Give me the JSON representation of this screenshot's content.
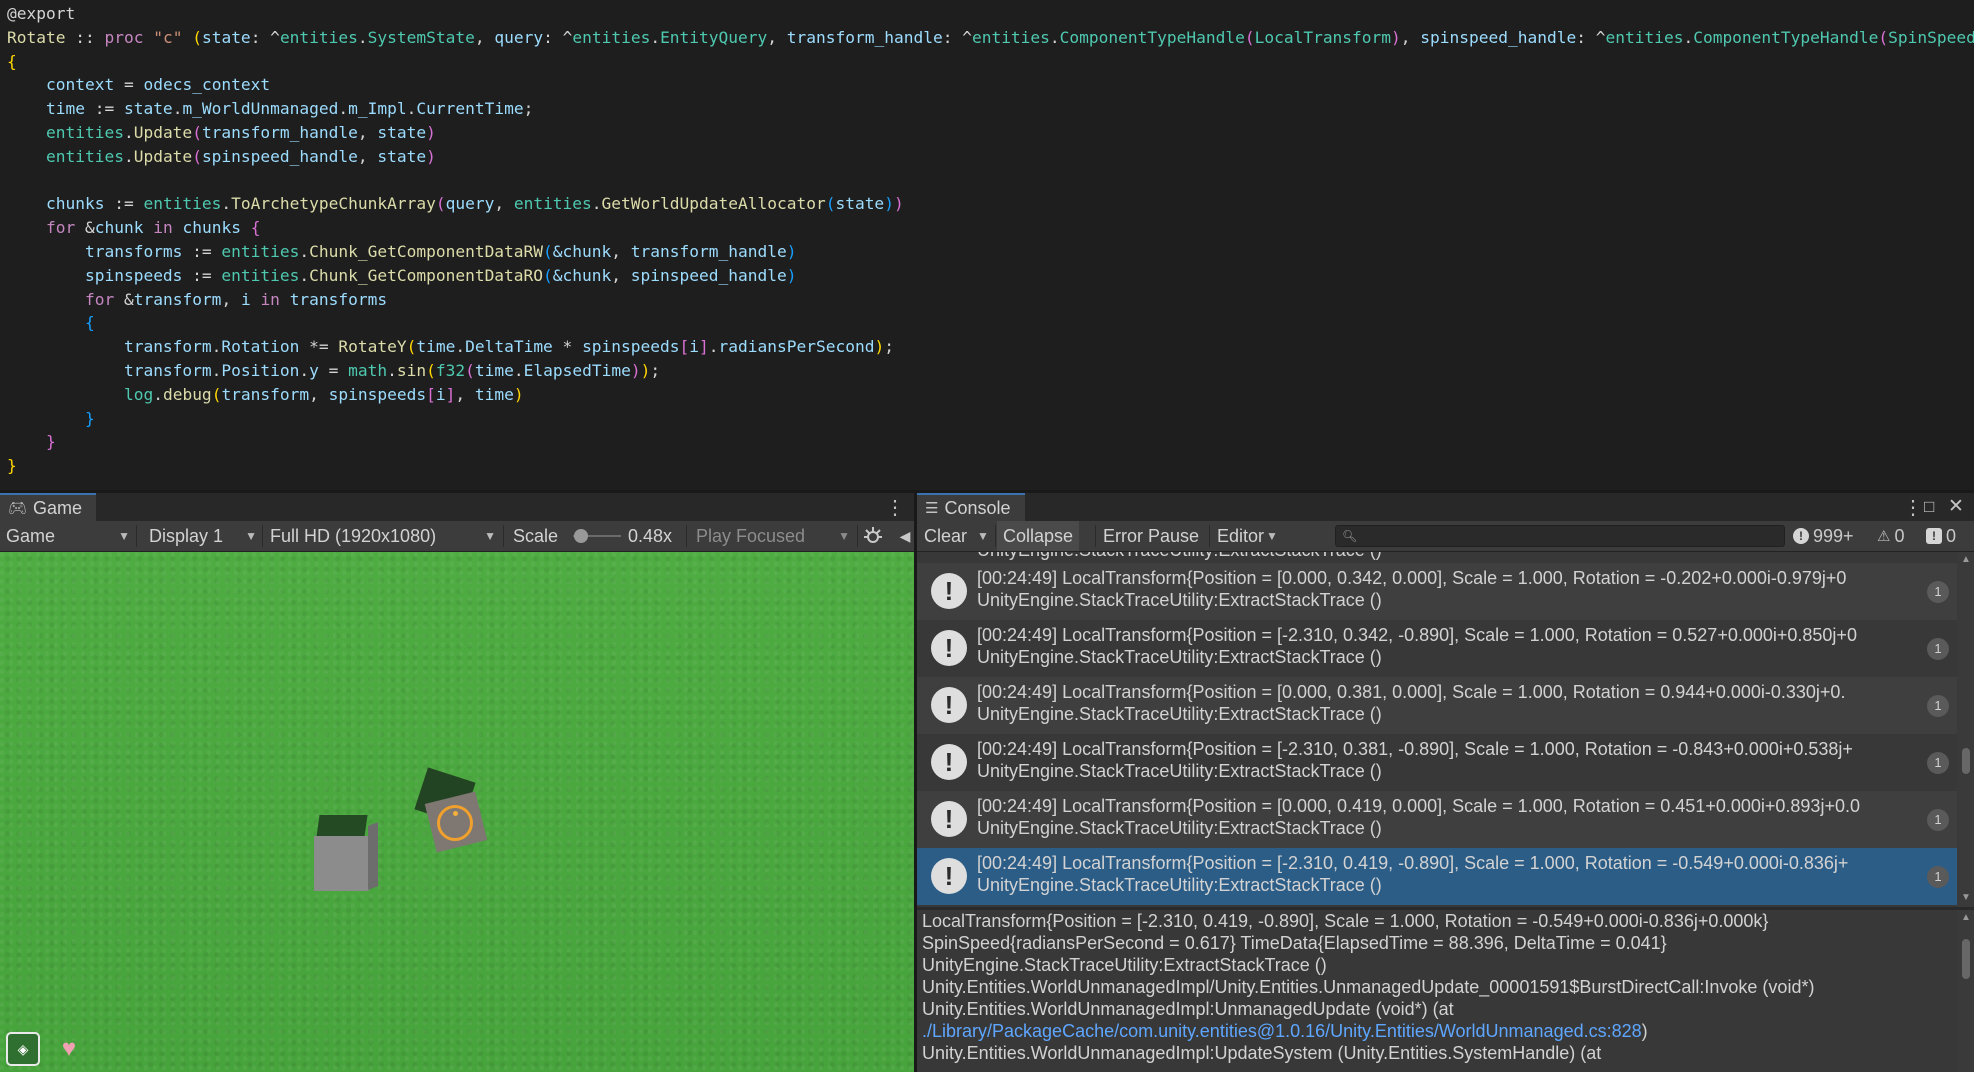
{
  "code_lines": [
    [
      {
        "t": "@export",
        "c": "attr"
      }
    ],
    [
      {
        "t": "Rotate",
        "c": "fn"
      },
      {
        "t": " :: ",
        "c": "op"
      },
      {
        "t": "proc",
        "c": "kw"
      },
      {
        "t": " ",
        "c": "op"
      },
      {
        "t": "\"c\"",
        "c": "str"
      },
      {
        "t": " ",
        "c": "op"
      },
      {
        "t": "(",
        "c": "b1"
      },
      {
        "t": "state",
        "c": "var"
      },
      {
        "t": ": ^",
        "c": "op"
      },
      {
        "t": "entities",
        "c": "ty"
      },
      {
        "t": ".",
        "c": "op"
      },
      {
        "t": "SystemState",
        "c": "ty"
      },
      {
        "t": ", ",
        "c": "op"
      },
      {
        "t": "query",
        "c": "var"
      },
      {
        "t": ": ^",
        "c": "op"
      },
      {
        "t": "entities",
        "c": "ty"
      },
      {
        "t": ".",
        "c": "op"
      },
      {
        "t": "EntityQuery",
        "c": "ty"
      },
      {
        "t": ", ",
        "c": "op"
      },
      {
        "t": "transform_handle",
        "c": "var"
      },
      {
        "t": ": ^",
        "c": "op"
      },
      {
        "t": "entities",
        "c": "ty"
      },
      {
        "t": ".",
        "c": "op"
      },
      {
        "t": "ComponentTypeHandle",
        "c": "ty"
      },
      {
        "t": "(",
        "c": "b2"
      },
      {
        "t": "LocalTransform",
        "c": "ty"
      },
      {
        "t": ")",
        "c": "b2"
      },
      {
        "t": ", ",
        "c": "op"
      },
      {
        "t": "spinspeed_handle",
        "c": "var"
      },
      {
        "t": ": ^",
        "c": "op"
      },
      {
        "t": "entities",
        "c": "ty"
      },
      {
        "t": ".",
        "c": "op"
      },
      {
        "t": "ComponentTypeHandle",
        "c": "ty"
      },
      {
        "t": "(",
        "c": "b2"
      },
      {
        "t": "SpinSpeed",
        "c": "ty"
      },
      {
        "t": ")",
        "c": "b2"
      },
      {
        "t": ")",
        "c": "b1"
      }
    ],
    [
      {
        "t": "{",
        "c": "b1"
      }
    ],
    [
      {
        "t": "    ",
        "c": "op"
      },
      {
        "t": "context",
        "c": "var"
      },
      {
        "t": " = ",
        "c": "op"
      },
      {
        "t": "odecs_context",
        "c": "var"
      }
    ],
    [
      {
        "t": "    ",
        "c": "op"
      },
      {
        "t": "time",
        "c": "var"
      },
      {
        "t": " := ",
        "c": "op"
      },
      {
        "t": "state",
        "c": "var"
      },
      {
        "t": ".",
        "c": "op"
      },
      {
        "t": "m_WorldUnmanaged",
        "c": "var"
      },
      {
        "t": ".",
        "c": "op"
      },
      {
        "t": "m_Impl",
        "c": "var"
      },
      {
        "t": ".",
        "c": "op"
      },
      {
        "t": "CurrentTime",
        "c": "var"
      },
      {
        "t": ";",
        "c": "op"
      }
    ],
    [
      {
        "t": "    ",
        "c": "op"
      },
      {
        "t": "entities",
        "c": "ty"
      },
      {
        "t": ".",
        "c": "op"
      },
      {
        "t": "Update",
        "c": "fn"
      },
      {
        "t": "(",
        "c": "b2"
      },
      {
        "t": "transform_handle",
        "c": "var"
      },
      {
        "t": ", ",
        "c": "op"
      },
      {
        "t": "state",
        "c": "var"
      },
      {
        "t": ")",
        "c": "b2"
      }
    ],
    [
      {
        "t": "    ",
        "c": "op"
      },
      {
        "t": "entities",
        "c": "ty"
      },
      {
        "t": ".",
        "c": "op"
      },
      {
        "t": "Update",
        "c": "fn"
      },
      {
        "t": "(",
        "c": "b2"
      },
      {
        "t": "spinspeed_handle",
        "c": "var"
      },
      {
        "t": ", ",
        "c": "op"
      },
      {
        "t": "state",
        "c": "var"
      },
      {
        "t": ")",
        "c": "b2"
      }
    ],
    [
      {
        "t": "",
        "c": "op"
      }
    ],
    [
      {
        "t": "    ",
        "c": "op"
      },
      {
        "t": "chunks",
        "c": "var"
      },
      {
        "t": " := ",
        "c": "op"
      },
      {
        "t": "entities",
        "c": "ty"
      },
      {
        "t": ".",
        "c": "op"
      },
      {
        "t": "ToArchetypeChunkArray",
        "c": "fn"
      },
      {
        "t": "(",
        "c": "b2"
      },
      {
        "t": "query",
        "c": "var"
      },
      {
        "t": ", ",
        "c": "op"
      },
      {
        "t": "entities",
        "c": "ty"
      },
      {
        "t": ".",
        "c": "op"
      },
      {
        "t": "GetWorldUpdateAllocator",
        "c": "fn"
      },
      {
        "t": "(",
        "c": "b3"
      },
      {
        "t": "state",
        "c": "var"
      },
      {
        "t": ")",
        "c": "b3"
      },
      {
        "t": ")",
        "c": "b2"
      }
    ],
    [
      {
        "t": "    ",
        "c": "op"
      },
      {
        "t": "for",
        "c": "kw"
      },
      {
        "t": " &",
        "c": "op"
      },
      {
        "t": "chunk",
        "c": "var"
      },
      {
        "t": " ",
        "c": "op"
      },
      {
        "t": "in",
        "c": "kw"
      },
      {
        "t": " ",
        "c": "op"
      },
      {
        "t": "chunks",
        "c": "var"
      },
      {
        "t": " ",
        "c": "op"
      },
      {
        "t": "{",
        "c": "b2"
      }
    ],
    [
      {
        "t": "        ",
        "c": "op"
      },
      {
        "t": "transforms",
        "c": "var"
      },
      {
        "t": " := ",
        "c": "op"
      },
      {
        "t": "entities",
        "c": "ty"
      },
      {
        "t": ".",
        "c": "op"
      },
      {
        "t": "Chunk_GetComponentDataRW",
        "c": "fn"
      },
      {
        "t": "(",
        "c": "b3"
      },
      {
        "t": "&chunk",
        "c": "var"
      },
      {
        "t": ", ",
        "c": "op"
      },
      {
        "t": "transform_handle",
        "c": "var"
      },
      {
        "t": ")",
        "c": "b3"
      }
    ],
    [
      {
        "t": "        ",
        "c": "op"
      },
      {
        "t": "spinspeeds",
        "c": "var"
      },
      {
        "t": " := ",
        "c": "op"
      },
      {
        "t": "entities",
        "c": "ty"
      },
      {
        "t": ".",
        "c": "op"
      },
      {
        "t": "Chunk_GetComponentDataRO",
        "c": "fn"
      },
      {
        "t": "(",
        "c": "b3"
      },
      {
        "t": "&chunk",
        "c": "var"
      },
      {
        "t": ", ",
        "c": "op"
      },
      {
        "t": "spinspeed_handle",
        "c": "var"
      },
      {
        "t": ")",
        "c": "b3"
      }
    ],
    [
      {
        "t": "        ",
        "c": "op"
      },
      {
        "t": "for",
        "c": "kw"
      },
      {
        "t": " &",
        "c": "op"
      },
      {
        "t": "transform",
        "c": "var"
      },
      {
        "t": ", ",
        "c": "op"
      },
      {
        "t": "i",
        "c": "var"
      },
      {
        "t": " ",
        "c": "op"
      },
      {
        "t": "in",
        "c": "kw"
      },
      {
        "t": " ",
        "c": "op"
      },
      {
        "t": "transforms",
        "c": "var"
      }
    ],
    [
      {
        "t": "        ",
        "c": "op"
      },
      {
        "t": "{",
        "c": "b3"
      }
    ],
    [
      {
        "t": "            ",
        "c": "op"
      },
      {
        "t": "transform",
        "c": "var"
      },
      {
        "t": ".",
        "c": "op"
      },
      {
        "t": "Rotation",
        "c": "var"
      },
      {
        "t": " *= ",
        "c": "op"
      },
      {
        "t": "RotateY",
        "c": "fn"
      },
      {
        "t": "(",
        "c": "b1"
      },
      {
        "t": "time",
        "c": "var"
      },
      {
        "t": ".",
        "c": "op"
      },
      {
        "t": "DeltaTime",
        "c": "var"
      },
      {
        "t": " * ",
        "c": "op"
      },
      {
        "t": "spinspeeds",
        "c": "var"
      },
      {
        "t": "[",
        "c": "b2"
      },
      {
        "t": "i",
        "c": "var"
      },
      {
        "t": "]",
        "c": "b2"
      },
      {
        "t": ".",
        "c": "op"
      },
      {
        "t": "radiansPerSecond",
        "c": "var"
      },
      {
        "t": ")",
        "c": "b1"
      },
      {
        "t": ";",
        "c": "op"
      }
    ],
    [
      {
        "t": "            ",
        "c": "op"
      },
      {
        "t": "transform",
        "c": "var"
      },
      {
        "t": ".",
        "c": "op"
      },
      {
        "t": "Position",
        "c": "var"
      },
      {
        "t": ".",
        "c": "op"
      },
      {
        "t": "y",
        "c": "var"
      },
      {
        "t": " = ",
        "c": "op"
      },
      {
        "t": "math",
        "c": "ty"
      },
      {
        "t": ".",
        "c": "op"
      },
      {
        "t": "sin",
        "c": "fn"
      },
      {
        "t": "(",
        "c": "b1"
      },
      {
        "t": "f32",
        "c": "ty"
      },
      {
        "t": "(",
        "c": "b2"
      },
      {
        "t": "time",
        "c": "var"
      },
      {
        "t": ".",
        "c": "op"
      },
      {
        "t": "ElapsedTime",
        "c": "var"
      },
      {
        "t": ")",
        "c": "b2"
      },
      {
        "t": ")",
        "c": "b1"
      },
      {
        "t": ";",
        "c": "op"
      }
    ],
    [
      {
        "t": "            ",
        "c": "op"
      },
      {
        "t": "log",
        "c": "ty"
      },
      {
        "t": ".",
        "c": "op"
      },
      {
        "t": "debug",
        "c": "fn"
      },
      {
        "t": "(",
        "c": "b1"
      },
      {
        "t": "transform",
        "c": "var"
      },
      {
        "t": ", ",
        "c": "op"
      },
      {
        "t": "spinspeeds",
        "c": "var"
      },
      {
        "t": "[",
        "c": "b2"
      },
      {
        "t": "i",
        "c": "var"
      },
      {
        "t": "]",
        "c": "b2"
      },
      {
        "t": ", ",
        "c": "op"
      },
      {
        "t": "time",
        "c": "var"
      },
      {
        "t": ")",
        "c": "b1"
      }
    ],
    [
      {
        "t": "        ",
        "c": "op"
      },
      {
        "t": "}",
        "c": "b3"
      }
    ],
    [
      {
        "t": "    ",
        "c": "op"
      },
      {
        "t": "}",
        "c": "b2"
      }
    ],
    [
      {
        "t": "}",
        "c": "b1"
      }
    ]
  ],
  "game": {
    "tab_label": "Game",
    "toolbar": {
      "mode": "Game",
      "display": "Display 1",
      "resolution": "Full HD (1920x1080)",
      "scale_label": "Scale",
      "scale_value": "0.48x",
      "play_focused": "Play Focused"
    }
  },
  "console": {
    "tab_label": "Console",
    "toolbar": {
      "clear": "Clear",
      "collapse": "Collapse",
      "error_pause": "Error Pause",
      "editor": "Editor",
      "search_placeholder": "",
      "log_count": "999+",
      "warning_count": "0",
      "error_count": "0"
    },
    "partial_row": "UnityEngine.StackTraceUtility:ExtractStackTrace ()",
    "entries": [
      {
        "line1": "[00:24:49] LocalTransform{Position = [0.000, 0.342, 0.000], Scale = 1.000, Rotation = -0.202+0.000i-0.979j+0",
        "line2": "UnityEngine.StackTraceUtility:ExtractStackTrace ()",
        "count": "1",
        "selected": false
      },
      {
        "line1": "[00:24:49] LocalTransform{Position = [-2.310, 0.342, -0.890], Scale = 1.000, Rotation = 0.527+0.000i+0.850j+0",
        "line2": "UnityEngine.StackTraceUtility:ExtractStackTrace ()",
        "count": "1",
        "selected": false
      },
      {
        "line1": "[00:24:49] LocalTransform{Position = [0.000, 0.381, 0.000], Scale = 1.000, Rotation = 0.944+0.000i-0.330j+0.",
        "line2": "UnityEngine.StackTraceUtility:ExtractStackTrace ()",
        "count": "1",
        "selected": false
      },
      {
        "line1": "[00:24:49] LocalTransform{Position = [-2.310, 0.381, -0.890], Scale = 1.000, Rotation = -0.843+0.000i+0.538j+",
        "line2": "UnityEngine.StackTraceUtility:ExtractStackTrace ()",
        "count": "1",
        "selected": false
      },
      {
        "line1": "[00:24:49] LocalTransform{Position = [0.000, 0.419, 0.000], Scale = 1.000, Rotation = 0.451+0.000i+0.893j+0.0",
        "line2": "UnityEngine.StackTraceUtility:ExtractStackTrace ()",
        "count": "1",
        "selected": false
      },
      {
        "line1": "[00:24:49] LocalTransform{Position = [-2.310, 0.419, -0.890], Scale = 1.000, Rotation = -0.549+0.000i-0.836j+",
        "line2": "UnityEngine.StackTraceUtility:ExtractStackTrace ()",
        "count": "1",
        "selected": true
      }
    ],
    "detail_lines": [
      {
        "text": "LocalTransform{Position = [-2.310, 0.419, -0.890], Scale = 1.000, Rotation = -0.549+0.000i-0.836j+0.000k}",
        "link": false
      },
      {
        "text": "SpinSpeed{radiansPerSecond = 0.617} TimeData{ElapsedTime = 88.396, DeltaTime = 0.041}",
        "link": false
      },
      {
        "text": "UnityEngine.StackTraceUtility:ExtractStackTrace ()",
        "link": false
      },
      {
        "text": "Unity.Entities.WorldUnmanagedImpl/Unity.Entities.UnmanagedUpdate_00001591$BurstDirectCall:Invoke (void*)",
        "link": false
      },
      {
        "text": "Unity.Entities.WorldUnmanagedImpl:UnmanagedUpdate (void*) (at",
        "link": false
      },
      {
        "text": "./Library/PackageCache/com.unity.entities@1.0.16/Unity.Entities/WorldUnmanaged.cs:828",
        "link": true,
        "suffix": ")"
      },
      {
        "text": "Unity.Entities.WorldUnmanagedImpl:UpdateSystem (Unity.Entities.SystemHandle) (at",
        "link": false
      }
    ]
  },
  "colors": {
    "editor_bg": "#1e1e1e",
    "panel_bg": "#383838",
    "selection": "#2c5d87",
    "grass": "#4ba63f",
    "link": "#5ea6ff",
    "gizmo": "#f0a02c"
  },
  "icons": {
    "game_tab": "gamepad-icon",
    "console_tab": "list-icon",
    "log_entry": "info-icon",
    "warning": "warning-icon",
    "error": "error-icon",
    "search": "search-icon",
    "mute": "speaker-icon",
    "stats": "bug-icon"
  }
}
